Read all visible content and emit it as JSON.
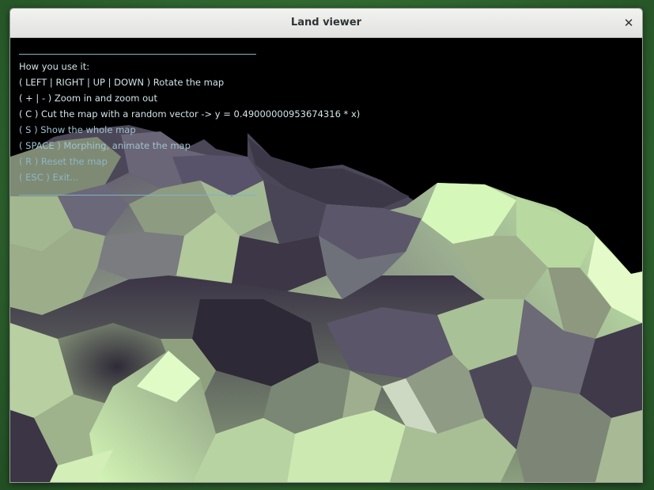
{
  "window": {
    "title": "Land viewer",
    "close_symbol": "✕"
  },
  "help": {
    "lines": [
      "How you use it:",
      "( LEFT | RIGHT | UP | DOWN ) Rotate the map",
      "( + | - ) Zoom in and zoom out",
      "( C ) Cut the map with a random vector -> y = 0.49000000953674316 * x)",
      "( S ) Show the whole map",
      "( SPACE ) Morphing, animate the map",
      "( R ) Reset the map",
      "( ESC ) Exit..."
    ]
  },
  "colors": {
    "terrain_light": "#c9f2ac",
    "terrain_mid": "#8fa87c",
    "terrain_dark": "#3a3344",
    "help_text": "#d2e3e8",
    "help_rule": "#7fb3c4",
    "background": "#000000"
  }
}
